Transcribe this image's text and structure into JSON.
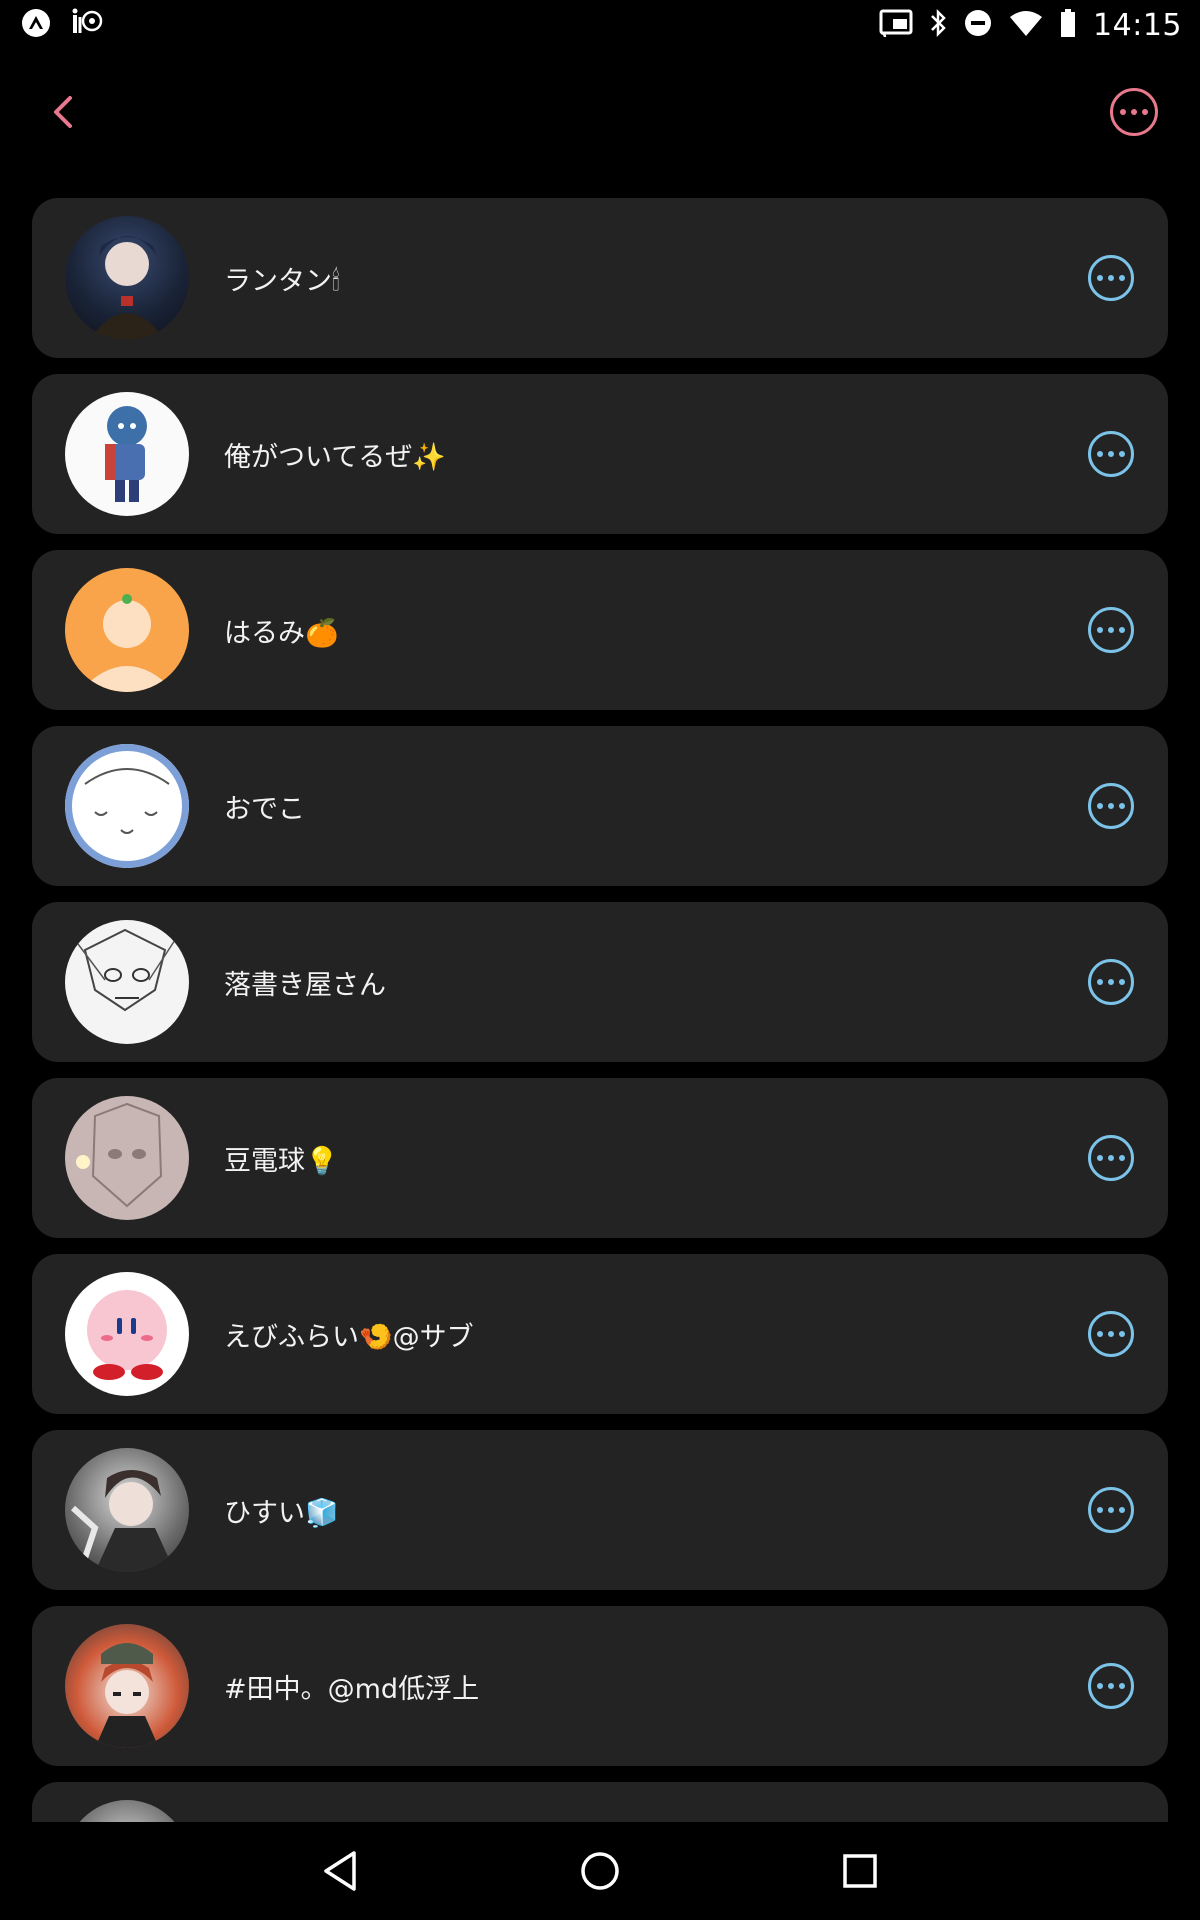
{
  "status_bar": {
    "time": "14:15"
  },
  "colors": {
    "background": "#000000",
    "card": "#232323",
    "header_accent": "#e8798c",
    "row_more_accent": "#7cc3ea"
  },
  "icons": {
    "back": "chevron-left-icon",
    "header_more": "more-horizontal-icon",
    "row_more": "more-horizontal-icon"
  },
  "users": [
    {
      "name": "ランタン🕯"
    },
    {
      "name": "俺がついてるぜ✨"
    },
    {
      "name": "はるみ🍊"
    },
    {
      "name": "おでこ"
    },
    {
      "name": "落書き屋さん"
    },
    {
      "name": "豆電球💡"
    },
    {
      "name": "えびふらい🍤@サブ"
    },
    {
      "name": "ひすい🧊"
    },
    {
      "name": "#田中。@md低浮上"
    },
    {
      "name": ""
    }
  ]
}
